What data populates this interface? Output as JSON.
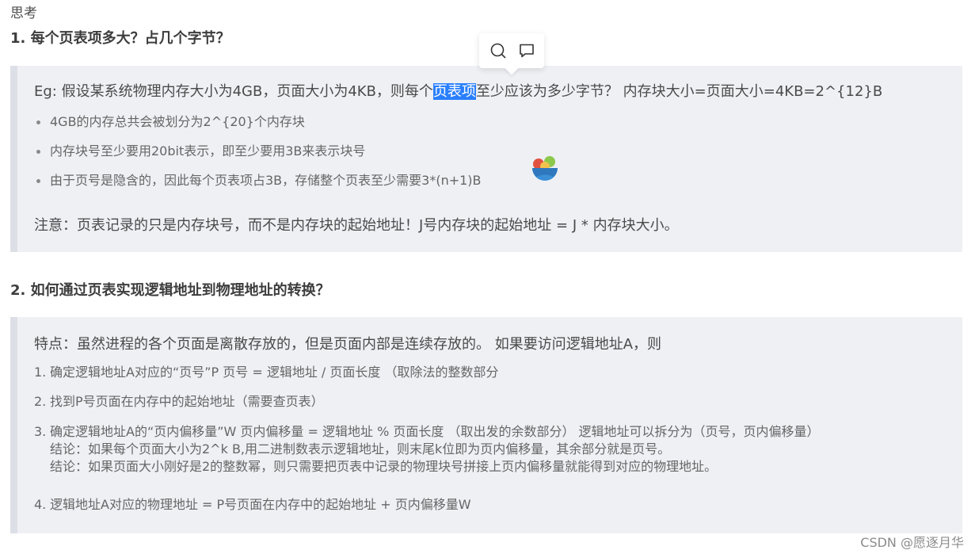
{
  "top_label": "思考",
  "section1": {
    "heading": "1. 每个页表项多大？占几个字节？",
    "lead_prefix": "Eg: 假设某系统物理内存大小为4GB，页面大小为4KB，则每个",
    "lead_highlight": "页表项",
    "lead_suffix": "至少应该为多少字节？  内存块大小=页面大小=4KB=2^{12}B",
    "bullets": [
      "4GB的内存总共会被划分为2^{20}个内存块",
      "内存块号至少要用20bit表示，即至少要用3B来表示块号",
      "由于页号是隐含的，因此每个页表项占3B，存储整个页表至少需要3*(n+1)B"
    ],
    "note": "注意：页表记录的只是内存块号，而不是内存块的起始地址！J号内存块的起始地址 = J * 内存块大小。"
  },
  "section2": {
    "heading": "2. 如何通过页表实现逻辑地址到物理地址的转换？",
    "lead": "特点：虽然进程的各个页面是离散存放的，但是页面内部是连续存放的。 如果要访问逻辑地址A，则",
    "steps": [
      {
        "num": "1.",
        "lines": [
          "确定逻辑地址A对应的“页号”P 页号 = 逻辑地址 / 页面长度  （取除法的整数部分"
        ]
      },
      {
        "num": "2.",
        "lines": [
          "找到P号页面在内存中的起始地址（需要查页表）"
        ]
      },
      {
        "num": "3.",
        "lines": [
          "确定逻辑地址A的“页内偏移量”W 页内偏移量 = 逻辑地址 % 页面长度  （取出发的余数部分）  逻辑地址可以拆分为（页号，页内偏移量）",
          "结论：如果每个页面大小为2^k B,用二进制数表示逻辑地址，则末尾k位即为页内偏移量，其余部分就是页号。",
          "结论：如果页面大小刚好是2的整数幂，则只需要把页表中记录的物理块号拼接上页内偏移量就能得到对应的物理地址。"
        ]
      },
      {
        "num": "4.",
        "lines": [
          "逻辑地址A对应的物理地址 = P号页面在内存中的起始地址 + 页内偏移量W"
        ]
      }
    ]
  },
  "toolbar": {
    "icons": [
      "search-icon",
      "comment-icon"
    ]
  },
  "watermark": "CSDN @愿逐月华",
  "colors": {
    "highlight": "#2a7fff",
    "quote_bg": "#eef0f4",
    "quote_border": "#dcdfe6"
  }
}
